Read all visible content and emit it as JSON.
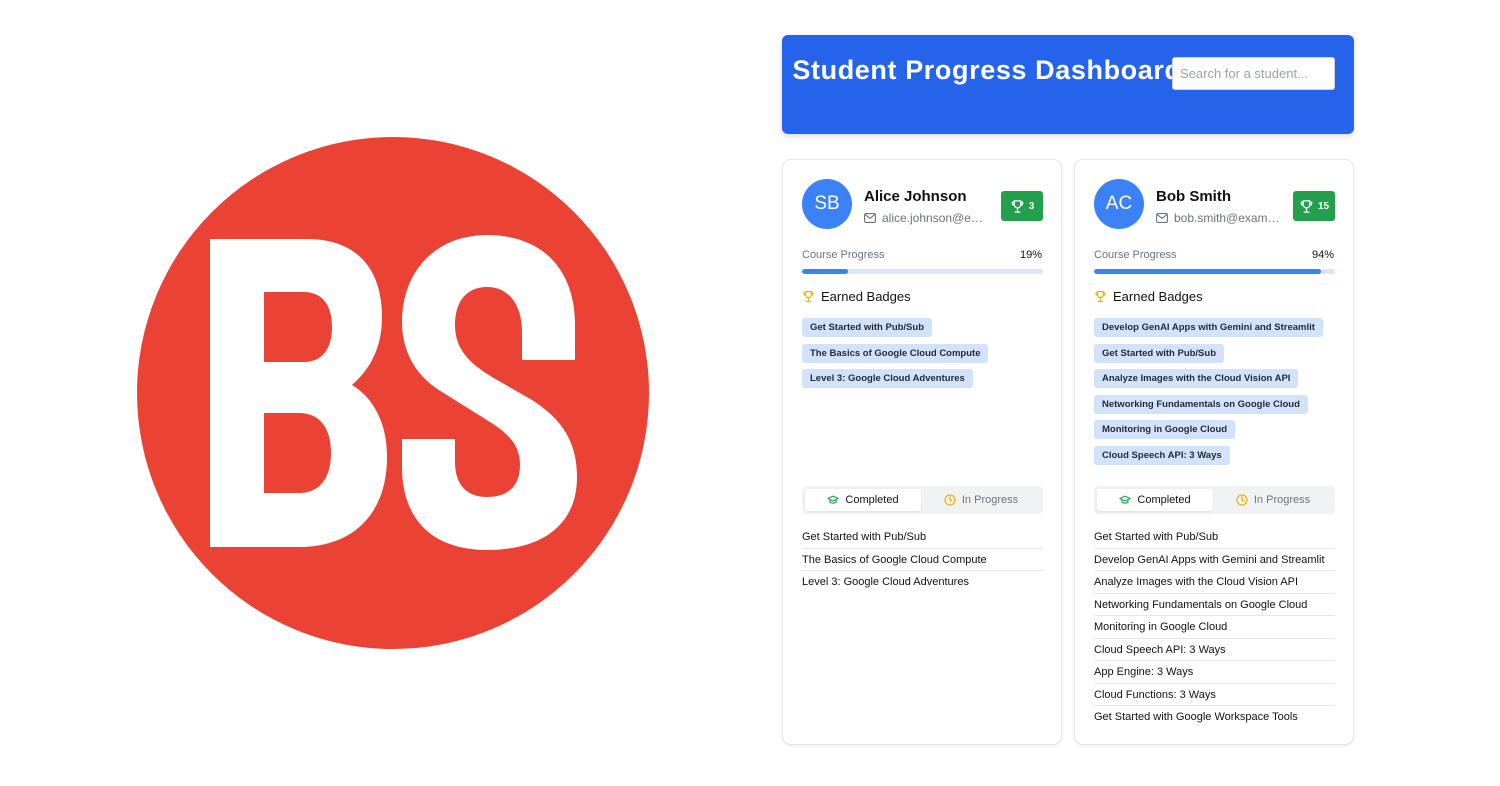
{
  "logo": {
    "text": "BS",
    "color": "#ea4335"
  },
  "header": {
    "title": "Student Progress Dashboard",
    "search_placeholder": "Search for a student...",
    "color": "#2563eb"
  },
  "labels": {
    "course_progress": "Course Progress",
    "earned_badges": "Earned Badges",
    "tab_completed": "Completed",
    "tab_in_progress": "In Progress"
  },
  "students": [
    {
      "initials": "SB",
      "name": "Alice Johnson",
      "email": "alice.johnson@example.com",
      "badge_count": "3",
      "progress_label": "19%",
      "progress": 0.19,
      "badges": [
        "Get Started with Pub/Sub",
        "The Basics of Google Cloud Compute",
        "Level 3: Google Cloud Adventures"
      ],
      "completed": [
        "Get Started with Pub/Sub",
        "The Basics of Google Cloud Compute",
        "Level 3: Google Cloud Adventures"
      ]
    },
    {
      "initials": "AC",
      "name": "Bob Smith",
      "email": "bob.smith@example.com",
      "badge_count": "15",
      "progress_label": "94%",
      "progress": 0.94,
      "badges": [
        "Develop GenAI Apps with Gemini and Streamlit",
        "Get Started with Pub/Sub",
        "Analyze Images with the Cloud Vision API",
        "Networking Fundamentals on Google Cloud",
        "Monitoring in Google Cloud",
        "Cloud Speech API: 3 Ways"
      ],
      "completed": [
        "Get Started with Pub/Sub",
        "Develop GenAI Apps with Gemini and Streamlit",
        "Analyze Images with the Cloud Vision API",
        "Networking Fundamentals on Google Cloud",
        "Monitoring in Google Cloud",
        "Cloud Speech API: 3 Ways",
        "App Engine: 3 Ways",
        "Cloud Functions: 3 Ways",
        "Get Started with Google Workspace Tools"
      ]
    }
  ],
  "icons": {
    "mail": "mail-icon",
    "trophy": "trophy-icon",
    "graduation": "graduation-cap-icon",
    "clock": "clock-icon"
  }
}
